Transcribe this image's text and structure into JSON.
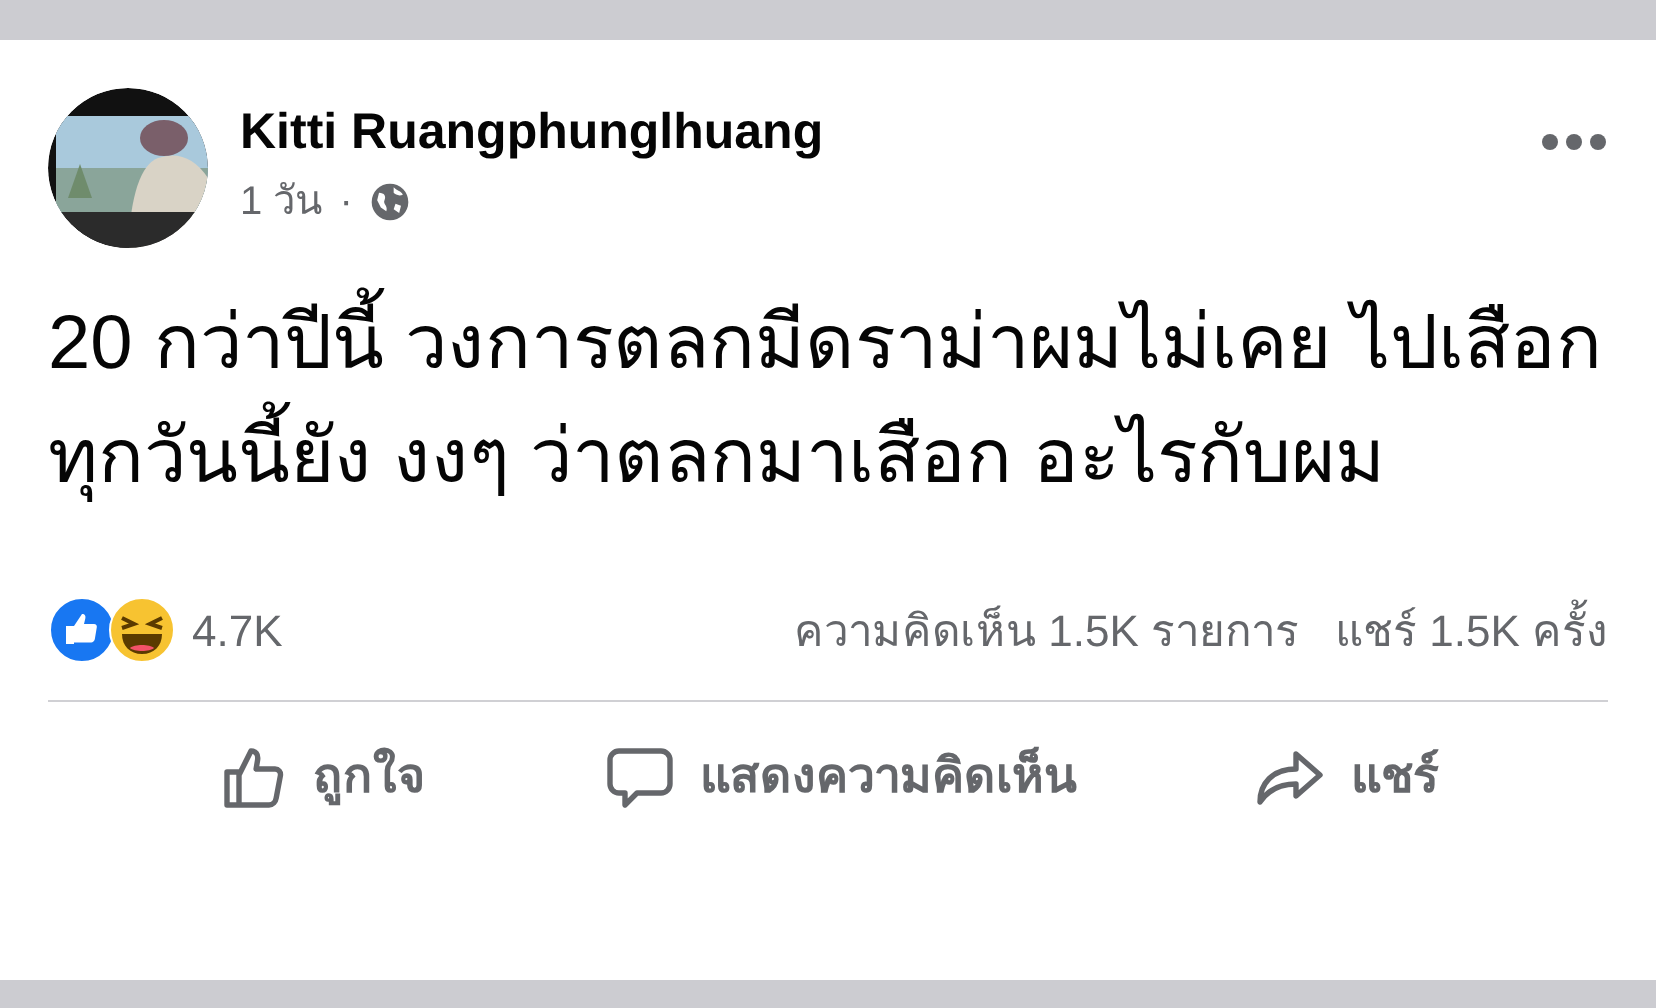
{
  "post": {
    "author": "Kitti Ruangphunglhuang",
    "time": "1 วัน",
    "separator": "·",
    "text": "20 กว่าปีนี้ วงการตลกมีดราม่าผมไม่เคย ไปเสือก ทุกวันนี้ยัง งงๆ ว่าตลกมาเสือก อะไรกับผม"
  },
  "stats": {
    "reactions": "4.7K",
    "comments": "ความคิดเห็น 1.5K รายการ",
    "shares": "แชร์ 1.5K ครั้ง"
  },
  "actions": [
    {
      "kind": "like",
      "label": "ถูกใจ"
    },
    {
      "kind": "comment",
      "label": "แสดงความคิดเห็น"
    },
    {
      "kind": "share",
      "label": "แชร์"
    }
  ]
}
